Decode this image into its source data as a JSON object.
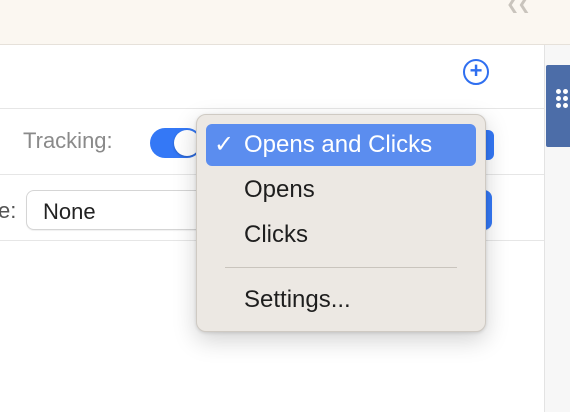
{
  "tracking": {
    "label": "Tracking:",
    "enabled": true
  },
  "second_row": {
    "label_fragment": "e:",
    "select_value": "None"
  },
  "toolbar": {
    "add_icon": "plus-circle-icon"
  },
  "tracking_menu": {
    "check_glyph": "✓",
    "items": [
      {
        "label": "Opens and Clicks",
        "selected": true
      },
      {
        "label": "Opens",
        "selected": false
      },
      {
        "label": "Clicks",
        "selected": false
      }
    ],
    "settings_label": "Settings..."
  },
  "colors": {
    "accent": "#3478f6",
    "menu_highlight": "#5b8def",
    "side_tab": "#4c6da8",
    "top_bar": "#fbf7f1"
  }
}
